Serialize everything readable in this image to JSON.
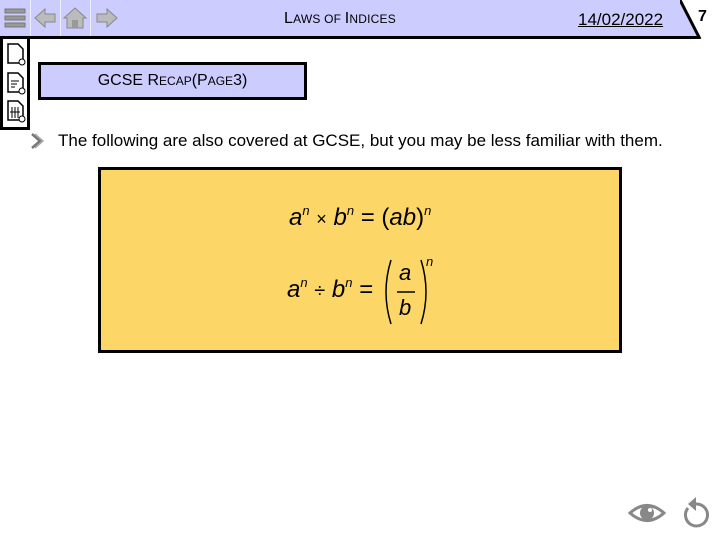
{
  "header": {
    "title_first": "L",
    "title_rest_sc": "AWS OF ",
    "title_second": "I",
    "title_rest2_sc": "NDICES",
    "date": "14/02/2022",
    "page_number": "7",
    "nav_icons": [
      "menu-icon",
      "back-arrow-icon",
      "home-icon",
      "forward-arrow-icon"
    ]
  },
  "sidebar": {
    "icons": [
      "blank-document-icon",
      "text-document-icon",
      "grid-document-icon"
    ]
  },
  "section": {
    "p1": "GCSE R",
    "p1_sc": "ECAP",
    "p2": " (P",
    "p2_sc": "AGE",
    "p3": " 3)"
  },
  "body": {
    "text": "The following are also covered at GCSE, but you may be less familiar with them."
  },
  "formulas": {
    "f1": {
      "a": "a",
      "n": "n",
      "times": "×",
      "b": "b",
      "eq": "=",
      "rhs_open": "(",
      "rhs": "ab",
      "rhs_close": ")"
    },
    "f2": {
      "a": "a",
      "n": "n",
      "div": "÷",
      "b": "b",
      "eq": "="
    }
  },
  "colors": {
    "header_bg": "#ccccff",
    "formula_bg": "#fcd666"
  },
  "footer": {
    "icons": [
      "eye-icon",
      "reset-icon"
    ]
  }
}
